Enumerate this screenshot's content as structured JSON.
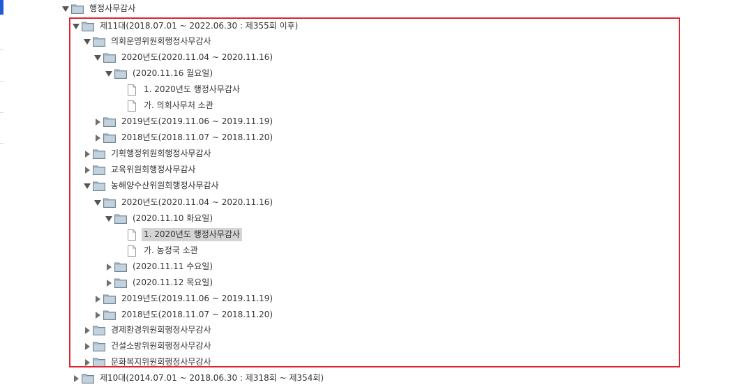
{
  "colors": {
    "accent_blue": "#1e5bd6",
    "highlight_border": "#e0242f",
    "selected_bg": "#d4d4d4",
    "folder_fill": "#a9bcc9",
    "folder_stroke": "#6f8696"
  },
  "tree": {
    "root": {
      "label": "행정사무감사",
      "expanded": true,
      "icon": "folder-icon"
    },
    "term11": {
      "label": "제11대(2018.07.01 ~ 2022.06.30 : 제355회 이후)",
      "expanded": true,
      "icon": "folder-icon"
    },
    "c1": {
      "label": "의회운영위원회행정사무감사",
      "expanded": true,
      "icon": "folder-icon"
    },
    "c1_y2020": {
      "label": "2020년도(2020.11.04 ~ 2020.11.16)",
      "expanded": true,
      "icon": "folder-icon"
    },
    "c1_y2020_d1": {
      "label": "(2020.11.16 월요일)",
      "expanded": true,
      "icon": "folder-icon"
    },
    "c1_doc1": {
      "label": "1. 2020년도 행정사무감사",
      "icon": "document-icon"
    },
    "c1_doc2": {
      "label": "가. 의회사무처 소관",
      "icon": "document-icon"
    },
    "c1_y2019": {
      "label": "2019년도(2019.11.06 ~ 2019.11.19)",
      "expanded": false,
      "icon": "folder-icon"
    },
    "c1_y2018": {
      "label": "2018년도(2018.11.07 ~ 2018.11.20)",
      "expanded": false,
      "icon": "folder-icon"
    },
    "c2": {
      "label": "기획행정위원회행정사무감사",
      "expanded": false,
      "icon": "folder-icon"
    },
    "c3": {
      "label": "교육위원회행정사무감사",
      "expanded": false,
      "icon": "folder-icon"
    },
    "c4": {
      "label": "농해양수산위원회행정사무감사",
      "expanded": true,
      "icon": "folder-icon"
    },
    "c4_y2020": {
      "label": "2020년도(2020.11.04 ~ 2020.11.16)",
      "expanded": true,
      "icon": "folder-icon"
    },
    "c4_y2020_d1": {
      "label": "(2020.11.10 화요일)",
      "expanded": true,
      "icon": "folder-icon"
    },
    "c4_doc1": {
      "label": "1. 2020년도 행정사무감사",
      "icon": "document-icon",
      "selected": true
    },
    "c4_doc2": {
      "label": "가. 농정국 소관",
      "icon": "document-icon"
    },
    "c4_y2020_d2": {
      "label": "(2020.11.11 수요일)",
      "expanded": false,
      "icon": "folder-icon"
    },
    "c4_y2020_d3": {
      "label": "(2020.11.12 목요일)",
      "expanded": false,
      "icon": "folder-icon"
    },
    "c4_y2019": {
      "label": "2019년도(2019.11.06 ~ 2019.11.19)",
      "expanded": false,
      "icon": "folder-icon"
    },
    "c4_y2018": {
      "label": "2018년도(2018.11.07 ~ 2018.11.20)",
      "expanded": false,
      "icon": "folder-icon"
    },
    "c5": {
      "label": "경제환경위원회행정사무감사",
      "expanded": false,
      "icon": "folder-icon"
    },
    "c6": {
      "label": "건설소방위원회행정사무감사",
      "expanded": false,
      "icon": "folder-icon"
    },
    "c7": {
      "label": "문화복지위원회행정사무감사",
      "expanded": false,
      "icon": "folder-icon"
    },
    "term10": {
      "label": "제10대(2014.07.01 ~ 2018.06.30 : 제318회 ~ 제354회)",
      "expanded": false,
      "icon": "folder-icon"
    }
  }
}
